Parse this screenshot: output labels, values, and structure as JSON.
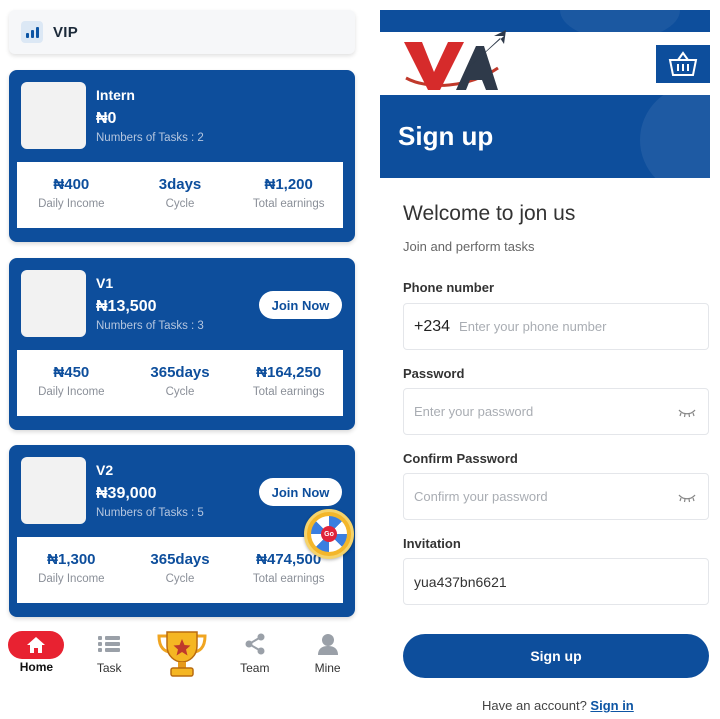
{
  "left": {
    "header": {
      "title": "VIP",
      "icon": "bar-chart-icon"
    },
    "cards": [
      {
        "name": "Intern",
        "price": "₦0",
        "tasks": "Numbers of Tasks : 2",
        "join_label": "",
        "stats": [
          {
            "value": "₦400",
            "label": "Daily Income"
          },
          {
            "value": "3days",
            "label": "Cycle"
          },
          {
            "value": "₦1,200",
            "label": "Total earnings"
          }
        ]
      },
      {
        "name": "V1",
        "price": "₦13,500",
        "tasks": "Numbers of Tasks : 3",
        "join_label": "Join Now",
        "stats": [
          {
            "value": "₦450",
            "label": "Daily Income"
          },
          {
            "value": "365days",
            "label": "Cycle"
          },
          {
            "value": "₦164,250",
            "label": "Total earnings"
          }
        ]
      },
      {
        "name": "V2",
        "price": "₦39,000",
        "tasks": "Numbers of Tasks : 5",
        "join_label": "Join Now",
        "stats": [
          {
            "value": "₦1,300",
            "label": "Daily Income"
          },
          {
            "value": "365days",
            "label": "Cycle"
          },
          {
            "value": "₦474,500",
            "label": "Total earnings"
          }
        ]
      }
    ],
    "wheel": {
      "label": "Go",
      "icon": "spin-wheel-icon"
    },
    "tabs": [
      {
        "label": "Home",
        "icon": "home-icon",
        "active": true
      },
      {
        "label": "Task",
        "icon": "list-icon"
      },
      {
        "label": "",
        "icon": "trophy-icon"
      },
      {
        "label": "Team",
        "icon": "share-icon"
      },
      {
        "label": "Mine",
        "icon": "user-icon"
      }
    ]
  },
  "right": {
    "logo_text": "VA",
    "cart_icon": "basket-icon",
    "title": "Sign up",
    "welcome": "Welcome to jon us",
    "subtitle": "Join and perform tasks",
    "phone": {
      "label": "Phone number",
      "code": "+234",
      "placeholder": "Enter your phone number"
    },
    "password": {
      "label": "Password",
      "placeholder": "Enter your password"
    },
    "confirm": {
      "label": "Confirm Password",
      "placeholder": "Confirm your password"
    },
    "invitation": {
      "label": "Invitation",
      "value": "yua437bn6621"
    },
    "submit_label": "Sign up",
    "footer_text": "Have an account?",
    "footer_link": "Sign in"
  },
  "colors": {
    "primary": "#0d4e9c",
    "accent": "#e82231",
    "muted": "#8a8f98"
  }
}
